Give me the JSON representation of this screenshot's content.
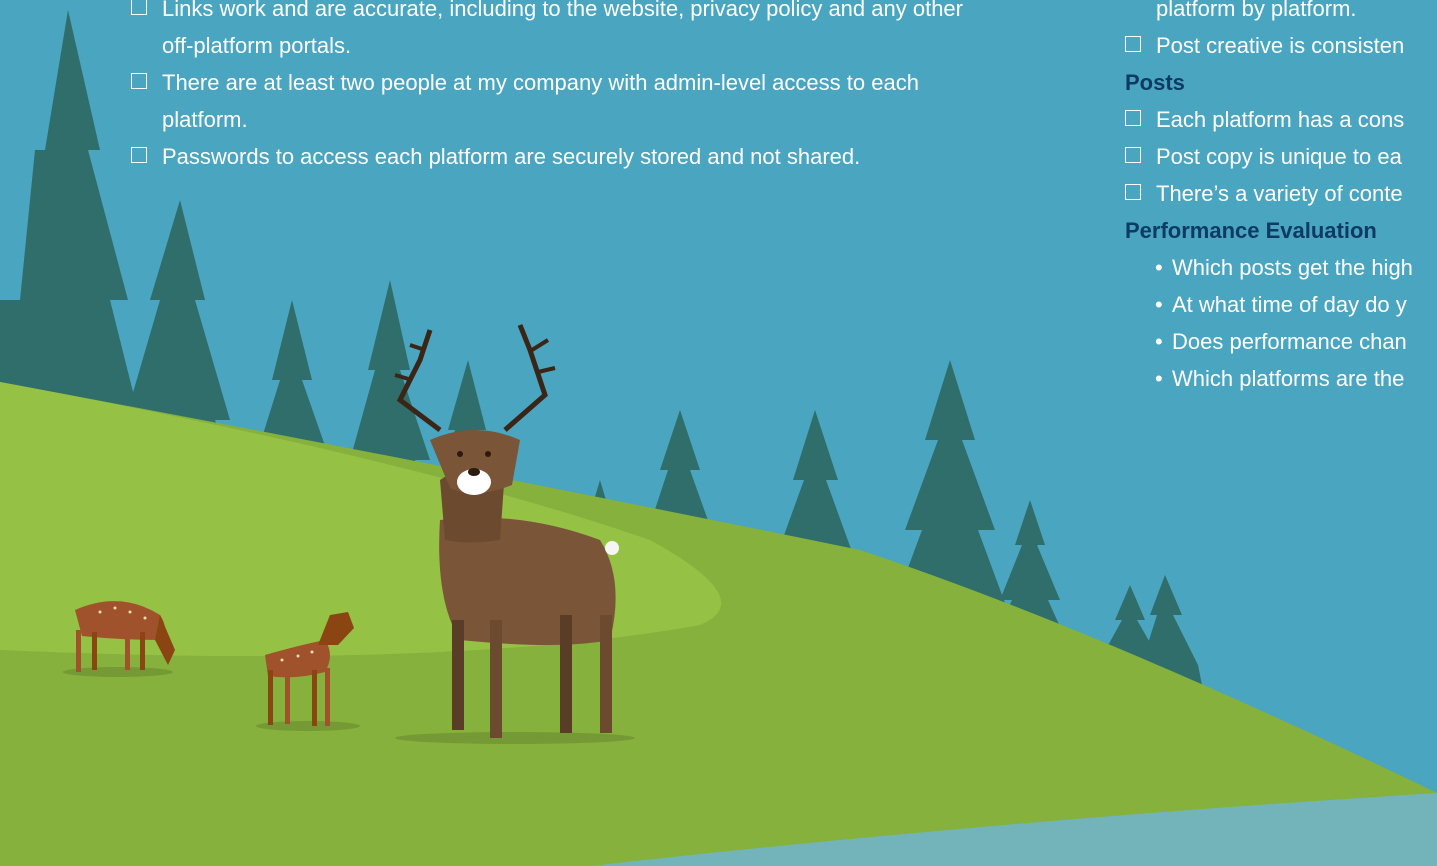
{
  "colors": {
    "sky": "#4aa5c1",
    "hill": "#8cbb3f",
    "hill_light": "#9ac443",
    "trees": "#2f6e6b",
    "heading": "#0d3b66",
    "text": "#ffffff"
  },
  "left_column": {
    "items": [
      {
        "lines": [
          "Links work and are accurate, including to the website, privacy policy and any other",
          "off-platform portals."
        ]
      },
      {
        "lines": [
          "There are at least two people at my company with admin-level access to each",
          "platform."
        ]
      },
      {
        "lines": [
          "Passwords to access each platform are securely stored and not shared."
        ]
      }
    ]
  },
  "right_column": {
    "top_continuation": "platform by platform.",
    "top_item": "Post creative is consisten",
    "posts_heading": "Posts",
    "posts_items": [
      "Each platform has a cons",
      "Post copy is unique to ea",
      "There’s a variety of conte"
    ],
    "performance_heading": "Performance Evaluation",
    "performance_bullets": [
      "Which posts get the high",
      "At what time of day do y",
      "Does performance chan",
      "Which platforms are the"
    ]
  },
  "illustration": {
    "icons": [
      "pine-tree-icon",
      "deer-icon",
      "fawn-icon",
      "doe-icon"
    ]
  }
}
